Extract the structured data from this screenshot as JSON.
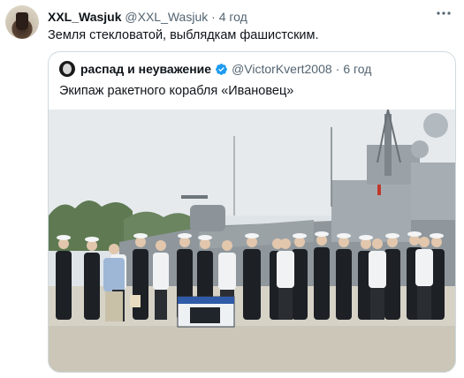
{
  "tweet": {
    "author": {
      "display_name": "XXL_Wasjuk",
      "handle": "@XXL_Wasjuk",
      "separator": "·",
      "time": "4 год"
    },
    "text": "Земля стекловатой, выблядкам фашистским.",
    "more_icon": "more-icon"
  },
  "quoted_tweet": {
    "author": {
      "display_name": "распад и неуважение",
      "handle": "@VictorKvert2008",
      "separator": "·",
      "time": "6 год",
      "verified": true
    },
    "text": "Экипаж ракетного корабля «Ивановец»"
  },
  "colors": {
    "text_primary": "#0f1419",
    "text_secondary": "#536471",
    "border": "#cfd9de",
    "verified_blue": "#1d9bf0"
  }
}
